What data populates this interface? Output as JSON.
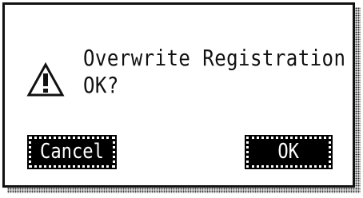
{
  "dialog": {
    "icon": "warning-triangle-icon",
    "message_line1": "Overwrite Registration",
    "message_line2": "OK?",
    "cancel_label": "Cancel",
    "ok_label": "OK"
  },
  "colors": {
    "background": "#ffffff",
    "foreground": "#111111",
    "button_bg": "#000000",
    "button_text": "#ffffff"
  }
}
